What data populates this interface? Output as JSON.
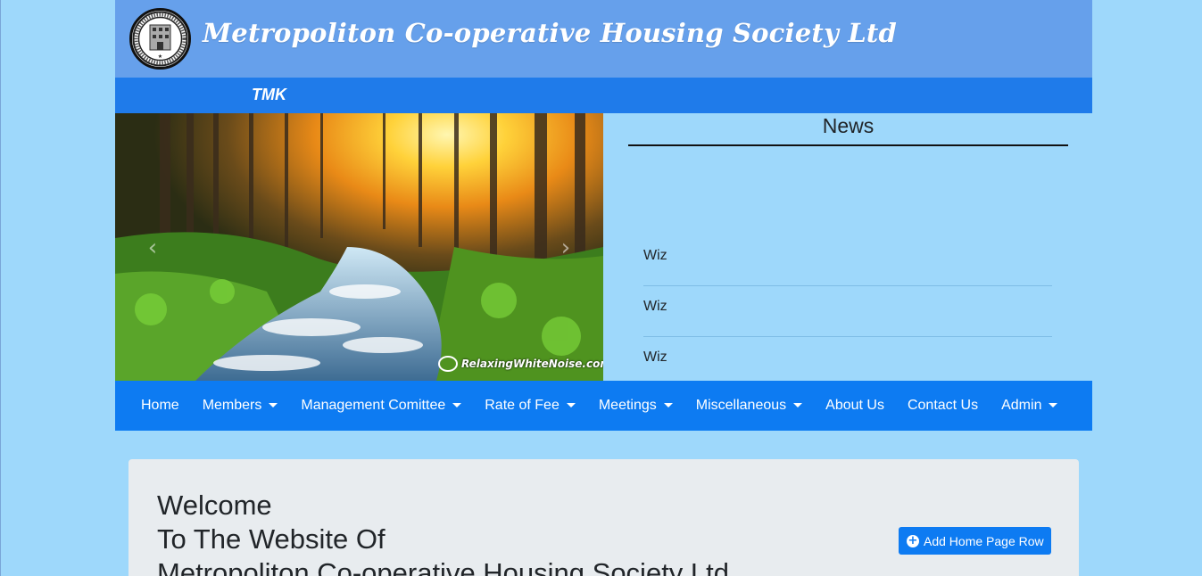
{
  "header": {
    "title": "Metropoliton Co-operative Housing Society Ltd",
    "logo_icon": "society-seal-icon"
  },
  "marquee": {
    "text": "TMK"
  },
  "carousel": {
    "prev_icon": "‹",
    "next_icon": "›",
    "watermark": "RelaxingWhiteNoise.com"
  },
  "news": {
    "title": "News",
    "items": [
      "Wiz",
      "Wiz",
      "Wiz"
    ]
  },
  "nav": {
    "items": [
      {
        "label": "Home",
        "dropdown": false
      },
      {
        "label": "Members",
        "dropdown": true
      },
      {
        "label": "Management Comittee",
        "dropdown": true
      },
      {
        "label": "Rate of Fee",
        "dropdown": true
      },
      {
        "label": "Meetings",
        "dropdown": true
      },
      {
        "label": "Miscellaneous",
        "dropdown": true
      },
      {
        "label": "About Us",
        "dropdown": false
      },
      {
        "label": "Contact Us",
        "dropdown": false
      },
      {
        "label": "Admin",
        "dropdown": true
      }
    ]
  },
  "jumbotron": {
    "line1": "Welcome",
    "line2": "To The Website Of",
    "line3": "Metropoliton Co-operative Housing Society Ltd",
    "add_button": "Add Home Page Row"
  },
  "colors": {
    "header_bg": "#66a0eb",
    "marquee_bg": "#1f7bea",
    "nav_bg": "#0d7bf2",
    "page_bg": "#9ed8fb",
    "jumbotron_bg": "#e8ecef"
  }
}
